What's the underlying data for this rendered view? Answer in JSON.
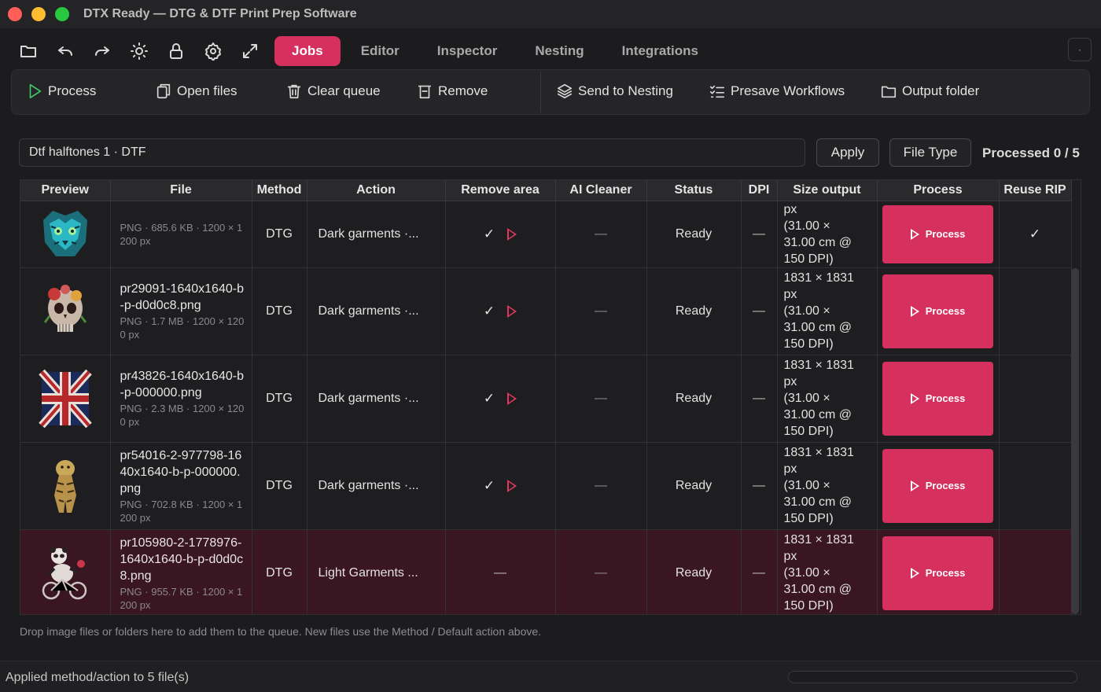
{
  "window": {
    "title": "DTX Ready — DTG & DTF Print Prep Software"
  },
  "nav": {
    "icons": [
      "folder-icon",
      "undo-icon",
      "redo-icon",
      "brightness-icon",
      "lock-icon",
      "gear-icon",
      "expand-icon"
    ],
    "tabs": [
      "Jobs",
      "Editor",
      "Inspector",
      "Nesting",
      "Integrations"
    ],
    "active_tab": "Jobs",
    "corner_label": "·"
  },
  "toolbar": {
    "process": "Process",
    "open_files": "Open files",
    "clear_queue": "Clear queue",
    "remove": "Remove",
    "send_to_nesting": "Send to Nesting",
    "presave_workflows": "Presave Workflows",
    "output_folder": "Output folder"
  },
  "preset": {
    "value": "Dtf halftones 1 · DTF",
    "apply": "Apply",
    "file_type": "File Type",
    "processed": "Processed 0 / 5"
  },
  "table": {
    "columns": [
      "Preview",
      "File",
      "Method",
      "Action",
      "Remove area",
      "AI Cleaner",
      "Status",
      "DPI",
      "Size output",
      "Process",
      "Reuse RIP"
    ],
    "rows": [
      {
        "preview": "tiger-face-neon",
        "name": "",
        "meta": "PNG · 685.6 KB · 1200 × 1200 px",
        "method": "DTG",
        "action": "Dark garments ·...",
        "remove_area": "✓",
        "ai_cleaner": "—",
        "status": "Ready",
        "dpi": "—",
        "size_lines": [
          "px",
          "(31.00 ×",
          "31.00 cm @",
          "150 DPI)"
        ],
        "process": "Process",
        "reuse_rip": "✓"
      },
      {
        "preview": "floral-skull",
        "name": "pr29091-1640x1640-b-p-d0d0c8.png",
        "meta": "PNG · 1.7 MB · 1200 × 1200 px",
        "method": "DTG",
        "action": "Dark garments ·...",
        "remove_area": "✓",
        "ai_cleaner": "—",
        "status": "Ready",
        "dpi": "—",
        "size_lines": [
          "1831 × 1831",
          "px",
          "(31.00 ×",
          "31.00 cm @",
          "150 DPI)"
        ],
        "process": "Process",
        "reuse_rip": ""
      },
      {
        "preview": "union-jack",
        "name": "pr43826-1640x1640-b-p-000000.png",
        "meta": "PNG · 2.3 MB · 1200 × 1200 px",
        "method": "DTG",
        "action": "Dark garments ·...",
        "remove_area": "✓",
        "ai_cleaner": "—",
        "status": "Ready",
        "dpi": "—",
        "size_lines": [
          "1831 × 1831",
          "px",
          "(31.00 ×",
          "31.00 cm @",
          "150 DPI)"
        ],
        "process": "Process",
        "reuse_rip": ""
      },
      {
        "preview": "walking-tiger",
        "name": "pr54016-2-977798-1640x1640-b-p-000000.png",
        "meta": "PNG · 702.8 KB · 1200 × 1200 px",
        "method": "DTG",
        "action": "Dark garments ·...",
        "remove_area": "✓",
        "ai_cleaner": "—",
        "status": "Ready",
        "dpi": "—",
        "size_lines": [
          "1831 × 1831",
          "px",
          "(31.00 ×",
          "31.00 cm @",
          "150 DPI)"
        ],
        "process": "Process",
        "reuse_rip": ""
      },
      {
        "preview": "panda-bicycle",
        "name": "pr105980-2-1778976-1640x1640-b-p-d0d0c8.png",
        "meta": "PNG · 955.7 KB · 1200 × 1200 px",
        "method": "DTG",
        "action": "Light Garments ...",
        "remove_area": "—",
        "ai_cleaner": "—",
        "status": "Ready",
        "dpi": "—",
        "size_lines": [
          "1831 × 1831",
          "px",
          "(31.00 ×",
          "31.00 cm @",
          "150 DPI)"
        ],
        "process": "Process",
        "reuse_rip": "",
        "selected": true
      }
    ]
  },
  "hint": "Drop image files or folders here to add them to the queue. New files use the Method / Default action above.",
  "status": {
    "text": "Applied method/action to 5 file(s)",
    "progress": 0
  },
  "colors": {
    "accent": "#d6305f",
    "selected_row": "#3a1522",
    "background": "#1c1c1e"
  }
}
